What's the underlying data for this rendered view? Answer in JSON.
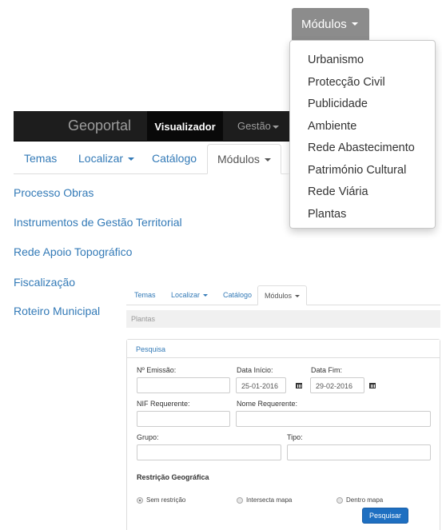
{
  "top_dropdown": {
    "button_label": "Módulos",
    "items": [
      "Urbanismo",
      "Protecção Civil",
      "Publicidade",
      "Ambiente",
      "Rede Abastecimento",
      "Património Cultural",
      "Rede Viária",
      "Plantas"
    ]
  },
  "navbar": {
    "brand": "Geoportal",
    "visualizador": "Visualizador",
    "gestao": "Gestão"
  },
  "main_tabs": [
    "Temas",
    "Localizar",
    "Catálogo",
    "Módulos"
  ],
  "sidebar": [
    "Processo Obras",
    "Instrumentos de Gestão Territorial",
    "Rede Apoio Topográfico",
    "Fiscalização",
    "Roteiro Municipal"
  ],
  "inner": {
    "tabs": [
      "Temas",
      "Localizar",
      "Catálogo",
      "Módulos"
    ],
    "breadcrumb": "Plantas",
    "panel_title": "Pesquisa",
    "labels": {
      "emissao": "Nº Emissão:",
      "data_inicio": "Data Início:",
      "data_fim": "Data Fim:",
      "nif": "NIF Requerente:",
      "nome": "Nome Requerente:",
      "grupo": "Grupo:",
      "tipo": "Tipo:"
    },
    "values": {
      "data_inicio": "25-01-2016",
      "data_fim": "29-02-2016"
    },
    "section_title": "Restrição Geográfica",
    "radios": [
      "Sem restrição",
      "Intersecta mapa",
      "Dentro mapa"
    ],
    "selected_radio": "Sem restrição",
    "search_button": "Pesquisar"
  },
  "colors": {
    "link": "#337ab7",
    "navbar": "#1d1d1d",
    "primary_button": "#1e6fc1",
    "dropdown_button": "#8c8c8c"
  }
}
